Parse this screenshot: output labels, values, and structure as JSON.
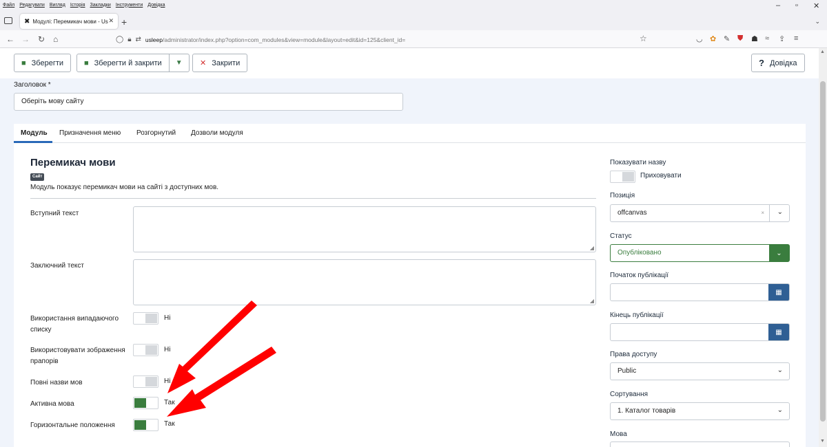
{
  "browser": {
    "menu": [
      "Файл",
      "Редагувати",
      "Вигляд",
      "Історія",
      "Закладки",
      "Інструменти",
      "Довідка"
    ],
    "tab_title": "Модулі: Перемикач мови - Us",
    "url_host": "usleep",
    "url_path": "/administrator/index.php?option=com_modules&view=module&layout=edit&id=125&client_id="
  },
  "toolbar": {
    "save": "Зберегти",
    "save_close": "Зберегти й закрити",
    "close": "Закрити",
    "help": "Довідка"
  },
  "title_field": {
    "label": "Заголовок *",
    "value": "Оберіть мову сайту"
  },
  "tabs": [
    "Модуль",
    "Призначення меню",
    "Розгорнутий",
    "Дозволи модуля"
  ],
  "module": {
    "title": "Перемикач мови",
    "badge": "Сайт",
    "description": "Модуль показує перемикач мови на сайті з доступних мов."
  },
  "fields": {
    "intro_text": "Вступний текст",
    "outro_text": "Заключний текст",
    "dropdown": {
      "label": "Використання випадаючого списку",
      "value": "Ні",
      "on": false
    },
    "flags": {
      "label": "Використовувати зображення прапорів",
      "value": "Ні",
      "on": false
    },
    "full_names": {
      "label": "Повні назви мов",
      "value": "Ні",
      "on": false
    },
    "active_lang": {
      "label": "Активна мова",
      "value": "Так",
      "on": true
    },
    "horizontal": {
      "label": "Горизонтальне положення",
      "value": "Так",
      "on": true
    }
  },
  "sidebar": {
    "show_title": {
      "label": "Показувати назву",
      "value": "Приховувати"
    },
    "position": {
      "label": "Позиція",
      "value": "offcanvas"
    },
    "status": {
      "label": "Статус",
      "value": "Опубліковано"
    },
    "publish_up": {
      "label": "Початок публікації",
      "value": ""
    },
    "publish_down": {
      "label": "Кінець публікації",
      "value": ""
    },
    "access": {
      "label": "Права доступу",
      "value": "Public"
    },
    "ordering": {
      "label": "Сортування",
      "value": "1. Каталог товарів"
    },
    "language": {
      "label": "Мова"
    }
  },
  "colors": {
    "accent_green": "#3a7d3e",
    "tab_underline": "#2a69b8",
    "calendar_button": "#2f5f94",
    "annotation_arrow": "#ff0000"
  }
}
